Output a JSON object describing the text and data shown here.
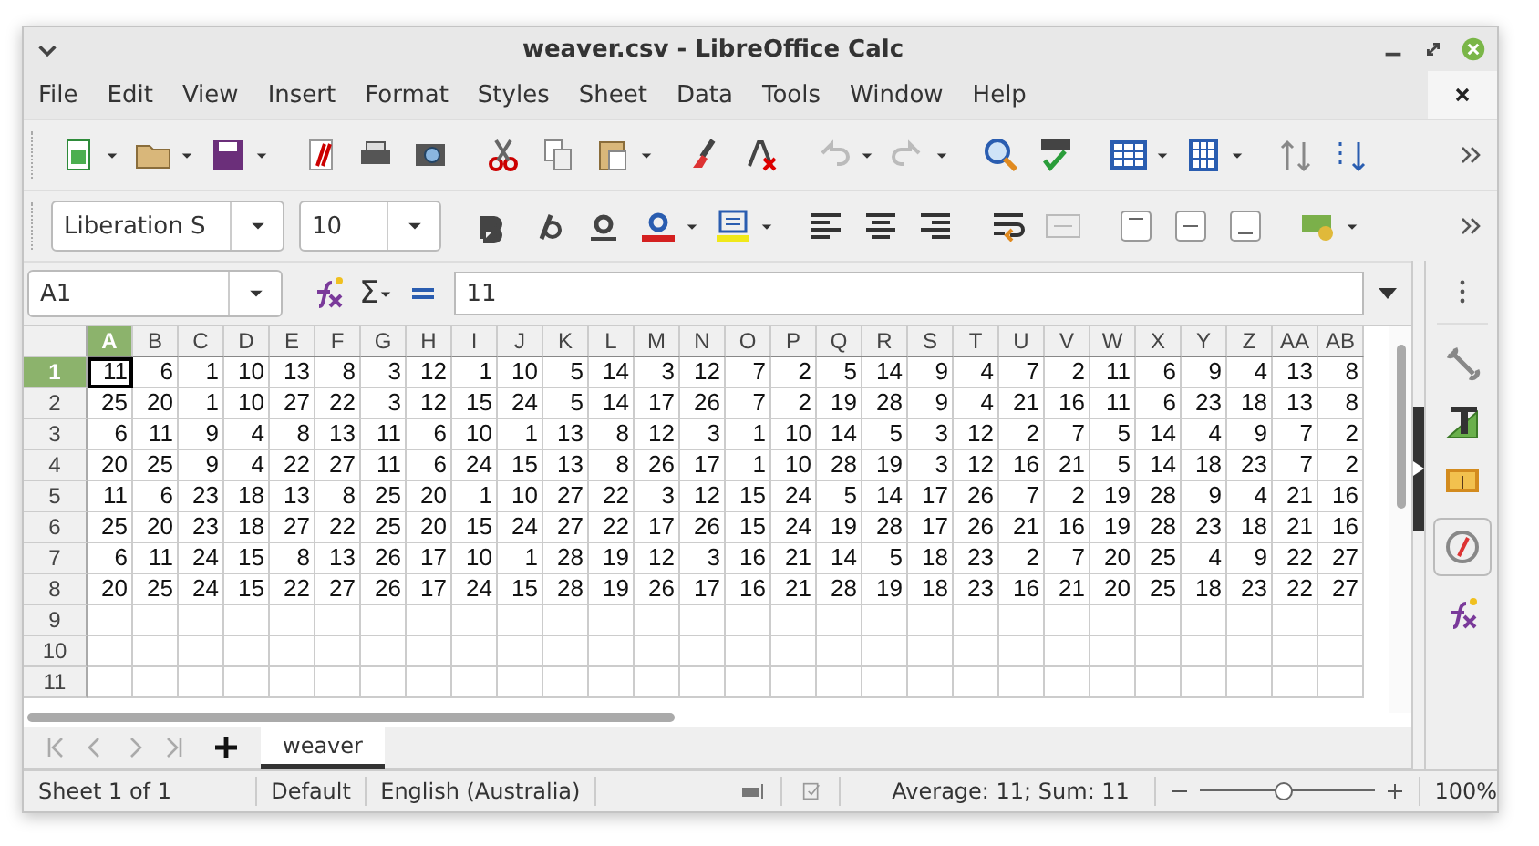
{
  "window": {
    "title": "weaver.csv - LibreOffice Calc"
  },
  "menu": [
    "File",
    "Edit",
    "View",
    "Insert",
    "Format",
    "Styles",
    "Sheet",
    "Data",
    "Tools",
    "Window",
    "Help"
  ],
  "font_name": {
    "value": "Liberation S"
  },
  "font_size": {
    "value": "10"
  },
  "name_box": {
    "value": "A1"
  },
  "sum_symbol": "Σ",
  "formula": {
    "value": "11"
  },
  "columns": [
    {
      "label": "A",
      "selected": true
    },
    {
      "label": "B",
      "selected": false
    },
    {
      "label": "C",
      "selected": false
    },
    {
      "label": "D",
      "selected": false
    },
    {
      "label": "E",
      "selected": false
    },
    {
      "label": "F",
      "selected": false
    },
    {
      "label": "G",
      "selected": false
    },
    {
      "label": "H",
      "selected": false
    },
    {
      "label": "I",
      "selected": false
    },
    {
      "label": "J",
      "selected": false
    },
    {
      "label": "K",
      "selected": false
    },
    {
      "label": "L",
      "selected": false
    },
    {
      "label": "M",
      "selected": false
    },
    {
      "label": "N",
      "selected": false
    },
    {
      "label": "O",
      "selected": false
    },
    {
      "label": "P",
      "selected": false
    },
    {
      "label": "Q",
      "selected": false
    },
    {
      "label": "R",
      "selected": false
    },
    {
      "label": "S",
      "selected": false
    },
    {
      "label": "T",
      "selected": false
    },
    {
      "label": "U",
      "selected": false
    },
    {
      "label": "V",
      "selected": false
    },
    {
      "label": "W",
      "selected": false
    },
    {
      "label": "X",
      "selected": false
    },
    {
      "label": "Y",
      "selected": false
    },
    {
      "label": "Z",
      "selected": false
    },
    {
      "label": "AA",
      "selected": false
    },
    {
      "label": "AB",
      "selected": false
    }
  ],
  "rows": [
    {
      "label": "1",
      "selected": true,
      "cells": [
        "11",
        "6",
        "1",
        "10",
        "13",
        "8",
        "3",
        "12",
        "1",
        "10",
        "5",
        "14",
        "3",
        "12",
        "7",
        "2",
        "5",
        "14",
        "9",
        "4",
        "7",
        "2",
        "11",
        "6",
        "9",
        "4",
        "13",
        "8"
      ]
    },
    {
      "label": "2",
      "selected": false,
      "cells": [
        "25",
        "20",
        "1",
        "10",
        "27",
        "22",
        "3",
        "12",
        "15",
        "24",
        "5",
        "14",
        "17",
        "26",
        "7",
        "2",
        "19",
        "28",
        "9",
        "4",
        "21",
        "16",
        "11",
        "6",
        "23",
        "18",
        "13",
        "8"
      ]
    },
    {
      "label": "3",
      "selected": false,
      "cells": [
        "6",
        "11",
        "9",
        "4",
        "8",
        "13",
        "11",
        "6",
        "10",
        "1",
        "13",
        "8",
        "12",
        "3",
        "1",
        "10",
        "14",
        "5",
        "3",
        "12",
        "2",
        "7",
        "5",
        "14",
        "4",
        "9",
        "7",
        "2"
      ]
    },
    {
      "label": "4",
      "selected": false,
      "cells": [
        "20",
        "25",
        "9",
        "4",
        "22",
        "27",
        "11",
        "6",
        "24",
        "15",
        "13",
        "8",
        "26",
        "17",
        "1",
        "10",
        "28",
        "19",
        "3",
        "12",
        "16",
        "21",
        "5",
        "14",
        "18",
        "23",
        "7",
        "2"
      ]
    },
    {
      "label": "5",
      "selected": false,
      "cells": [
        "11",
        "6",
        "23",
        "18",
        "13",
        "8",
        "25",
        "20",
        "1",
        "10",
        "27",
        "22",
        "3",
        "12",
        "15",
        "24",
        "5",
        "14",
        "17",
        "26",
        "7",
        "2",
        "19",
        "28",
        "9",
        "4",
        "21",
        "16"
      ]
    },
    {
      "label": "6",
      "selected": false,
      "cells": [
        "25",
        "20",
        "23",
        "18",
        "27",
        "22",
        "25",
        "20",
        "15",
        "24",
        "27",
        "22",
        "17",
        "26",
        "15",
        "24",
        "19",
        "28",
        "17",
        "26",
        "21",
        "16",
        "19",
        "28",
        "23",
        "18",
        "21",
        "16"
      ]
    },
    {
      "label": "7",
      "selected": false,
      "cells": [
        "6",
        "11",
        "24",
        "15",
        "8",
        "13",
        "26",
        "17",
        "10",
        "1",
        "28",
        "19",
        "12",
        "3",
        "16",
        "21",
        "14",
        "5",
        "18",
        "23",
        "2",
        "7",
        "20",
        "25",
        "4",
        "9",
        "22",
        "27"
      ]
    },
    {
      "label": "8",
      "selected": false,
      "cells": [
        "20",
        "25",
        "24",
        "15",
        "22",
        "27",
        "26",
        "17",
        "24",
        "15",
        "28",
        "19",
        "26",
        "17",
        "16",
        "21",
        "28",
        "19",
        "18",
        "23",
        "16",
        "21",
        "20",
        "25",
        "18",
        "23",
        "22",
        "27"
      ]
    },
    {
      "label": "9",
      "selected": false
    },
    {
      "label": "10",
      "selected": false
    },
    {
      "label": "11",
      "selected": false
    }
  ],
  "sheet_tabs": [
    {
      "label": "weaver",
      "selected": true
    }
  ],
  "status_bar": {
    "sheet": "Sheet 1 of 1",
    "page_style": "Default",
    "language": "English (Australia)",
    "selection": "Average: 11; Sum: 11",
    "zoom": {
      "level": 0.48
    },
    "zoom_percent": "100%"
  }
}
